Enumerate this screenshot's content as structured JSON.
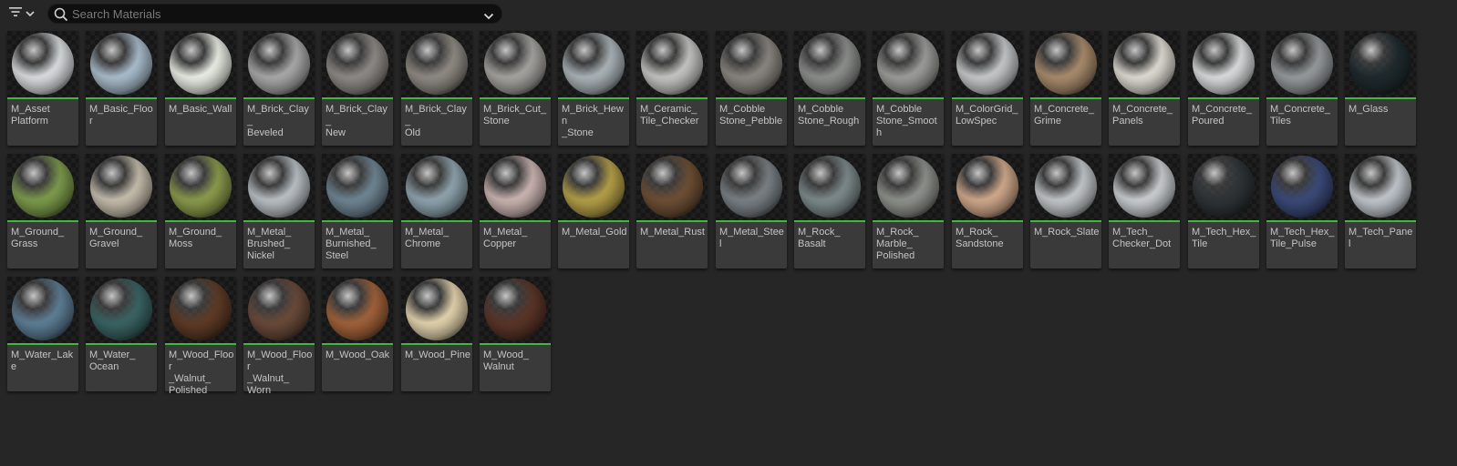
{
  "search": {
    "placeholder": "Search Materials"
  },
  "icons": {
    "filter": "filter-icon",
    "dropdown": "chevron-down-icon",
    "search": "search-icon"
  },
  "accent_color": "#3fb83f",
  "materials": [
    {
      "label": "M_Asset\nPlatform",
      "color": "#d9dcde"
    },
    {
      "label": "M_Basic_Floor",
      "color": "#a9bccb"
    },
    {
      "label": "M_Basic_Wall",
      "color": "#eaede4"
    },
    {
      "label": "M_Brick_Clay_\nBeveled",
      "color": "#a8a8a8"
    },
    {
      "label": "M_Brick_Clay_\nNew",
      "color": "#8e8a86"
    },
    {
      "label": "M_Brick_Clay_\nOld",
      "color": "#8f8a83"
    },
    {
      "label": "M_Brick_Cut_\nStone",
      "color": "#a5a39f"
    },
    {
      "label": "M_Brick_Hewn\n_Stone",
      "color": "#aab3b8"
    },
    {
      "label": "M_Ceramic_\nTile_Checker",
      "color": "#c4c4c2"
    },
    {
      "label": "M_Cobble\nStone_Pebble",
      "color": "#8a8680"
    },
    {
      "label": "M_Cobble\nStone_Rough",
      "color": "#8d8f8d"
    },
    {
      "label": "M_Cobble\nStone_Smooth",
      "color": "#9c9c9a"
    },
    {
      "label": "M_ColorGrid_\nLowSpec",
      "color": "#c5c7c9"
    },
    {
      "label": "M_Concrete_\nGrime",
      "color": "#a88b6c"
    },
    {
      "label": "M_Concrete_\nPanels",
      "color": "#dedad2"
    },
    {
      "label": "M_Concrete_\nPoured",
      "color": "#d8dadb"
    },
    {
      "label": "M_Concrete_\nTiles",
      "color": "#95999b"
    },
    {
      "label": "M_Glass",
      "color": "#1f2a2e"
    },
    {
      "label": "M_Ground_\nGrass",
      "color": "#7c9a4c"
    },
    {
      "label": "M_Ground_\nGravel",
      "color": "#c5bcab"
    },
    {
      "label": "M_Ground_\nMoss",
      "color": "#8a9a4c"
    },
    {
      "label": "M_Metal_\nBrushed_\nNickel",
      "color": "#b9bfc4"
    },
    {
      "label": "M_Metal_\nBurnished_\nSteel",
      "color": "#6f8593"
    },
    {
      "label": "M_Metal_\nChrome",
      "color": "#8fa3ad"
    },
    {
      "label": "M_Metal_\nCopper",
      "color": "#c9b3b0"
    },
    {
      "label": "M_Metal_Gold",
      "color": "#b39e48"
    },
    {
      "label": "M_Metal_Rust",
      "color": "#6e4f35"
    },
    {
      "label": "M_Metal_Steel",
      "color": "#7a8186"
    },
    {
      "label": "M_Rock_\nBasalt",
      "color": "#7d8a8c"
    },
    {
      "label": "M_Rock_\nMarble_\nPolished",
      "color": "#8f918c"
    },
    {
      "label": "M_Rock_\nSandstone",
      "color": "#cfa88a"
    },
    {
      "label": "M_Rock_Slate",
      "color": "#c2c6c8"
    },
    {
      "label": "M_Tech_\nChecker_Dot",
      "color": "#c9cdd0"
    },
    {
      "label": "M_Tech_Hex_\nTile",
      "color": "#2e3336"
    },
    {
      "label": "M_Tech_Hex_\nTile_Pulse",
      "color": "#3b4a78"
    },
    {
      "label": "M_Tech_Panel",
      "color": "#bfc5cb"
    },
    {
      "label": "M_Water_Lake",
      "color": "#5d7e96"
    },
    {
      "label": "M_Water_\nOcean",
      "color": "#3a6463"
    },
    {
      "label": "M_Wood_Floor\n_Walnut_\nPolished",
      "color": "#5e3b26"
    },
    {
      "label": "M_Wood_Floor\n_Walnut_\nWorn",
      "color": "#6a4a3a"
    },
    {
      "label": "M_Wood_Oak",
      "color": "#a0623a"
    },
    {
      "label": "M_Wood_Pine",
      "color": "#e2d1ac"
    },
    {
      "label": "M_Wood_\nWalnut",
      "color": "#5a3528"
    }
  ]
}
